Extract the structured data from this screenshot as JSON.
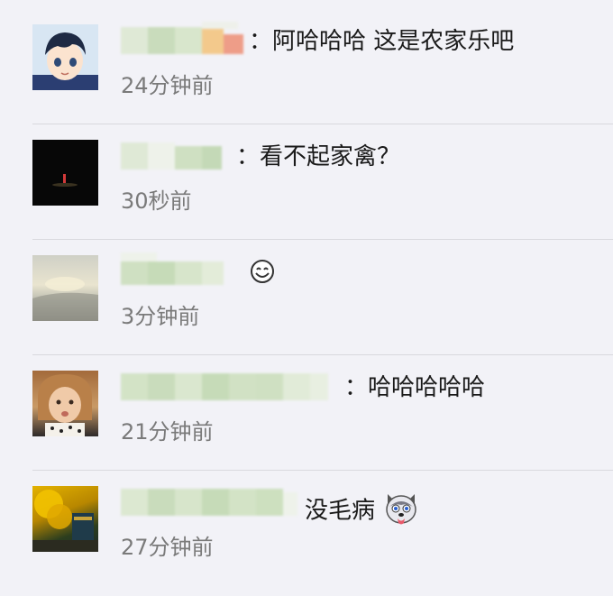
{
  "comments": [
    {
      "avatar": "anime-boy-avatar",
      "text": "：阿哈哈哈 这是农家乐吧",
      "time": "24分钟前"
    },
    {
      "avatar": "dark-photo-avatar",
      "text": "：看不起家禽？",
      "time": "30秒前"
    },
    {
      "avatar": "sky-photo-avatar",
      "text": "",
      "emoji": "smile-emoji",
      "time": "3分钟前"
    },
    {
      "avatar": "child-photo-avatar",
      "text": "：哈哈哈哈哈",
      "time": "21分钟前"
    },
    {
      "avatar": "tree-photo-avatar",
      "text": "没毛病",
      "emoji": "husky-face-emoji",
      "time": "27分钟前"
    }
  ],
  "colors": {
    "background": "#f2f2f7",
    "text": "#1a1a1a",
    "time": "#7a7a7a",
    "blur": "#c8dcbc"
  }
}
